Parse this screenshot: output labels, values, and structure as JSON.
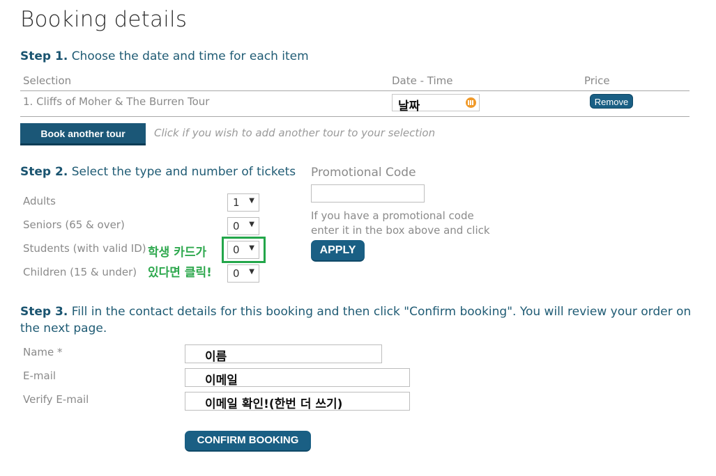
{
  "page_title": "Booking details",
  "step1": {
    "label": "Step 1.",
    "text": "Choose the date and time for each item",
    "headers": {
      "selection": "Selection",
      "date_time": "Date - Time",
      "price": "Price"
    },
    "item": {
      "name": "1. Cliffs of Moher & The Burren Tour",
      "date_value": "날짜",
      "remove_label": "Remove"
    },
    "book_another_label": "Book another tour",
    "book_another_hint": "Click if you wish to add another tour to your selection"
  },
  "step2": {
    "label": "Step 2.",
    "text": "Select the type and number of tickets",
    "tickets": [
      {
        "type": "Adults",
        "value": "1"
      },
      {
        "type": "Seniors (65 & over)",
        "value": "0"
      },
      {
        "type": "Students (with valid ID)",
        "value": "0"
      },
      {
        "type": "Children (15 & under)",
        "value": "0"
      }
    ],
    "annotation_line1": "학생 카드가",
    "annotation_line2": "있다면 클릭!",
    "annotation_color": "#23a64a",
    "promo": {
      "label": "Promotional Code",
      "input_value": "",
      "help_line1": "If you have a promotional code",
      "help_line2": "enter it in the box above and click",
      "apply_label": "APPLY"
    }
  },
  "step3": {
    "label": "Step 3.",
    "text_line1": "Fill in the contact details for this booking and then click \"Confirm booking\". You will review your order on",
    "text_line2": "the next page.",
    "fields": {
      "name_label": "Name *",
      "name_value": "이름",
      "email_label": "E-mail",
      "email_value": "이메일",
      "verify_label": "Verify E-mail",
      "verify_value": "이메일 확인!(한번 더 쓰기)"
    },
    "confirm_label": "CONFIRM BOOKING"
  },
  "colors": {
    "accent": "#1a5f84",
    "step_heading": "#1f5b74",
    "calendar_icon": "#f09a2a"
  }
}
